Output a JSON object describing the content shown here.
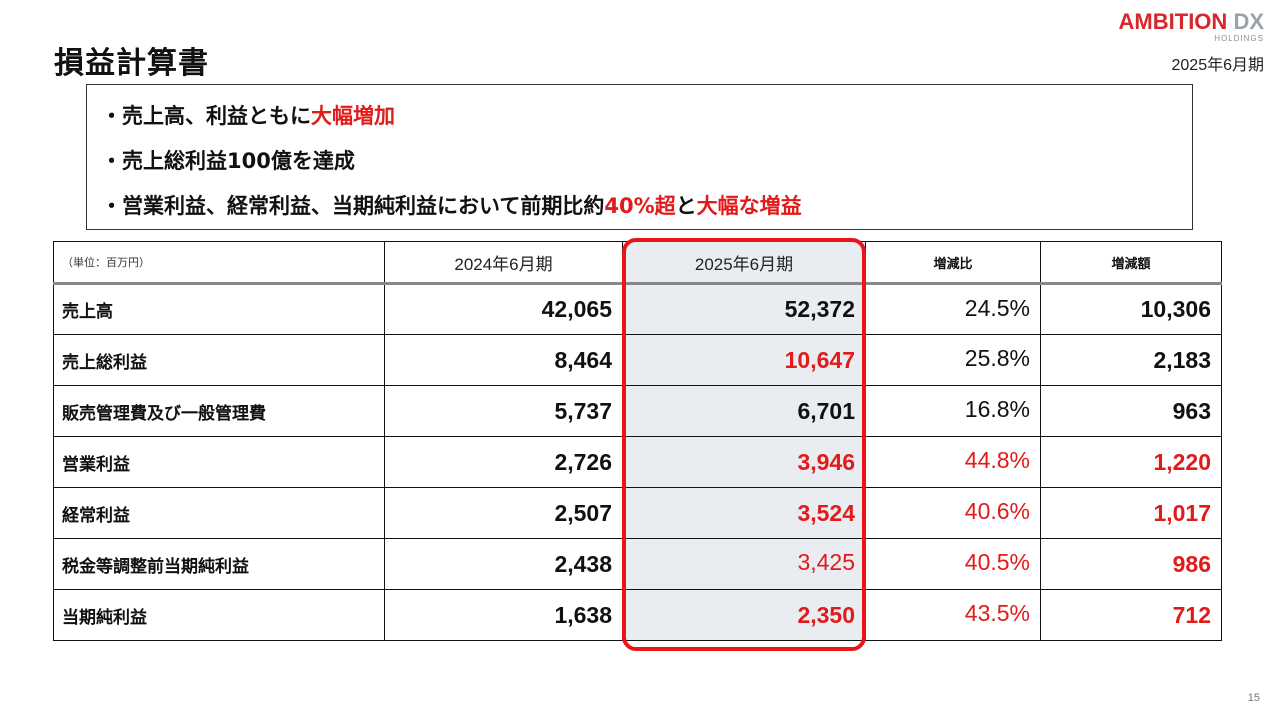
{
  "title": "損益計算書",
  "logo": {
    "main": "AMBITION",
    "accent": "DX",
    "sub": "HOLDINGS"
  },
  "period": "2025年6月期",
  "summary": {
    "line1": {
      "prefix": "・売上高、利益ともに",
      "emph": "大幅増加"
    },
    "line2": {
      "text": "・売上総利益100億を達成"
    },
    "line3": {
      "prefix": "・営業利益、経常利益、当期純利益において前期比約",
      "emph1": "40%超",
      "mid": "と",
      "emph2": "大幅な増益"
    }
  },
  "table": {
    "unit": "（単位：百万円）",
    "headers": [
      "2024年6月期",
      "2025年6月期",
      "増減比",
      "増減額"
    ],
    "rows": [
      {
        "label": "売上高",
        "y2024": "42,065",
        "y2025": "52,372",
        "ratio": "24.5%",
        "diff": "10,306"
      },
      {
        "label": "売上総利益",
        "y2024": "8,464",
        "y2025": "10,647",
        "ratio": "25.8%",
        "diff": "2,183"
      },
      {
        "label": "販売管理費及び一般管理費",
        "y2024": "5,737",
        "y2025": "6,701",
        "ratio": "16.8%",
        "diff": "963"
      },
      {
        "label": "営業利益",
        "y2024": "2,726",
        "y2025": "3,946",
        "ratio": "44.8%",
        "diff": "1,220"
      },
      {
        "label": "経常利益",
        "y2024": "2,507",
        "y2025": "3,524",
        "ratio": "40.6%",
        "diff": "1,017"
      },
      {
        "label": "税金等調整前当期純利益",
        "y2024": "2,438",
        "y2025": "3,425",
        "ratio": "40.5%",
        "diff": "986"
      },
      {
        "label": "当期純利益",
        "y2024": "1,638",
        "y2025": "2,350",
        "ratio": "43.5%",
        "diff": "712"
      }
    ]
  },
  "colors": {
    "accent_red": "#e21a1a",
    "highlight_fill": "#e9edf2",
    "highlight_border": "#e8151b"
  },
  "page_number": "15"
}
